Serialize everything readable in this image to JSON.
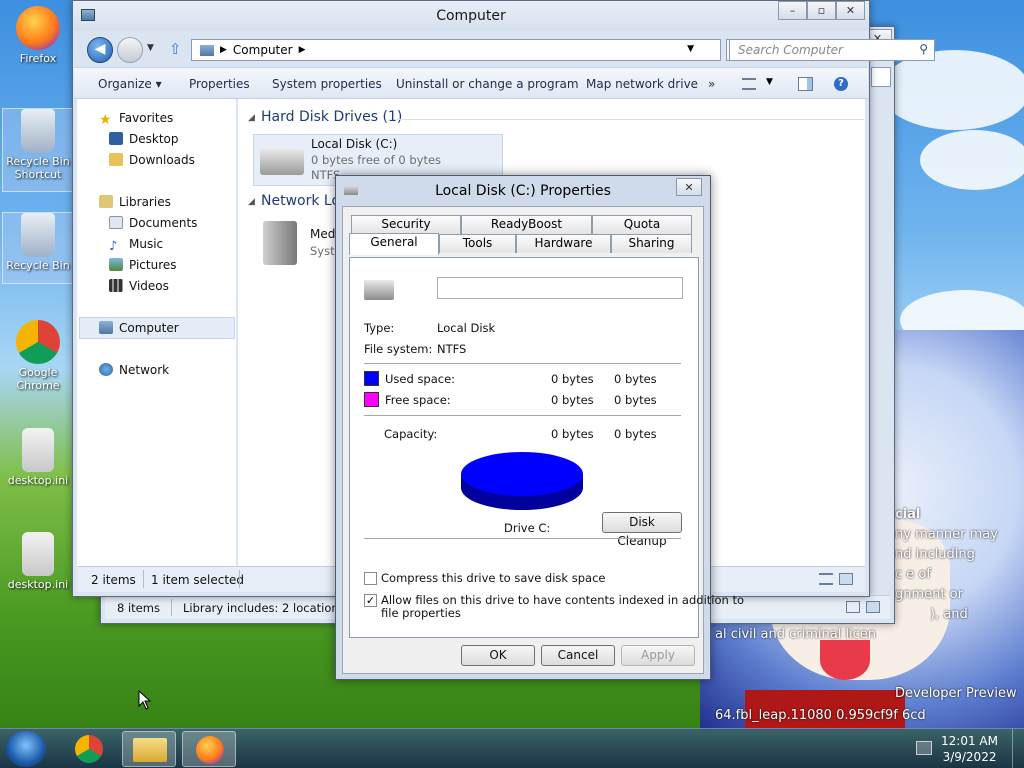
{
  "desktop": {
    "icons": [
      {
        "label": "Firefox"
      },
      {
        "label": "Recycle Bin Shortcut"
      },
      {
        "label": "Recycle Bin"
      },
      {
        "label": "Google Chrome"
      },
      {
        "label": "desktop.ini"
      },
      {
        "label": "desktop.ini"
      }
    ],
    "watermark": {
      "l1": "cial",
      "l2": "ny manner may",
      "l3": "nd including",
      "l4": "c      e of",
      "l5": "gnment or",
      "l6": "), and",
      "l7": "al civil and criminal licen",
      "l8": "Developer Preview",
      "l9": "64.fbl_leap.11080   0.959cf9f   6cd"
    }
  },
  "back_window": {
    "status_items": "8 items",
    "status_library": "Library includes: 2 locations"
  },
  "explorer": {
    "title": "Computer",
    "address": "Computer",
    "search_placeholder": "Search Computer",
    "toolbar": {
      "organize": "Organize ▾",
      "properties": "Properties",
      "system_properties": "System properties",
      "uninstall": "Uninstall or change a program",
      "map_drive": "Map network drive",
      "more": "»"
    },
    "nav": {
      "favorites": "Favorites",
      "desktop": "Desktop",
      "downloads": "Downloads",
      "libraries": "Libraries",
      "documents": "Documents",
      "music": "Music",
      "pictures": "Pictures",
      "videos": "Videos",
      "computer": "Computer",
      "network": "Network"
    },
    "hdd_header": "Hard Disk Drives (1)",
    "drive": {
      "name": "Local Disk (C:)",
      "free": "0 bytes free of 0 bytes",
      "fs": "NTFS"
    },
    "network_header": "Network Lo",
    "media": {
      "name": "Medi",
      "sub": "Syste"
    },
    "status": {
      "items": "2 items",
      "selected": "1 item selected"
    }
  },
  "dialog": {
    "title": "Local Disk (C:) Properties",
    "tabs_back": [
      "Security",
      "ReadyBoost",
      "Quota"
    ],
    "tabs_front": [
      "General",
      "Tools",
      "Hardware",
      "Sharing"
    ],
    "name_value": "",
    "type_label": "Type:",
    "type_value": "Local Disk",
    "fs_label": "File system:",
    "fs_value": "NTFS",
    "used_label": "Used space:",
    "used_bytes": "0 bytes",
    "used_size": "0 bytes",
    "free_label": "Free space:",
    "free_bytes": "0 bytes",
    "free_size": "0 bytes",
    "capacity_label": "Capacity:",
    "capacity_bytes": "0 bytes",
    "capacity_size": "0 bytes",
    "drive_label": "Drive C:",
    "cleanup": "Disk Cleanup",
    "compress": "Compress this drive to save disk space",
    "compress_checked": false,
    "index_line1": "Allow files on this drive to have contents indexed in addition to",
    "index_line2": "file properties",
    "index_checked": true,
    "ok": "OK",
    "cancel": "Cancel",
    "apply": "Apply",
    "colors": {
      "used": "#0000ff",
      "free": "#ff00ff"
    }
  },
  "taskbar": {
    "time": "12:01 AM",
    "date": "3/9/2022"
  }
}
